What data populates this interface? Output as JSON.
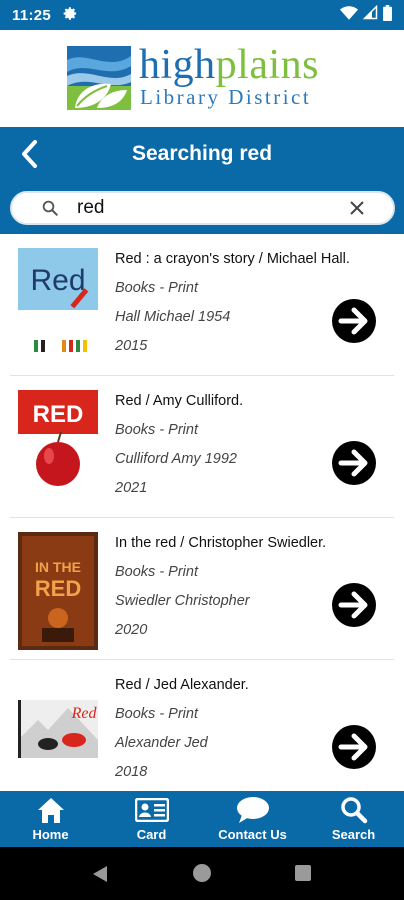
{
  "status_bar": {
    "time": "11:25",
    "icons": [
      "gear-icon",
      "wifi-icon",
      "signal-icon",
      "battery-icon"
    ]
  },
  "logo": {
    "word_high": "high",
    "word_plains": "plains",
    "subtitle": "Library District"
  },
  "header": {
    "title": "Searching red",
    "back_icon": "chevron-left-icon"
  },
  "search": {
    "value": "red",
    "icon": "search-icon",
    "clear_icon": "close-icon"
  },
  "colors": {
    "brand_blue": "#0a6aa8",
    "logo_green": "#7fbf3f",
    "logo_blue": "#1f6fb0"
  },
  "results": [
    {
      "title": "Red : a crayon's story / Michael Hall.",
      "format": "Books - Print",
      "author": "Hall Michael 1954",
      "year": "2015",
      "cover": "cover-red-crayon"
    },
    {
      "title": "Red / Amy Culliford.",
      "format": "Books - Print",
      "author": "Culliford Amy 1992",
      "year": "2021",
      "cover": "cover-red-apple"
    },
    {
      "title": "In the red / Christopher Swiedler.",
      "format": "Books - Print",
      "author": "Swiedler Christopher",
      "year": "2020",
      "cover": "cover-in-the-red"
    },
    {
      "title": "Red / Jed Alexander.",
      "format": "Books - Print",
      "author": "Alexander Jed",
      "year": "2018",
      "cover": "cover-red-jed"
    }
  ],
  "nav": [
    {
      "label": "Home",
      "icon": "home-icon"
    },
    {
      "label": "Card",
      "icon": "card-icon"
    },
    {
      "label": "Contact Us",
      "icon": "chat-icon"
    },
    {
      "label": "Search",
      "icon": "search-icon"
    }
  ]
}
